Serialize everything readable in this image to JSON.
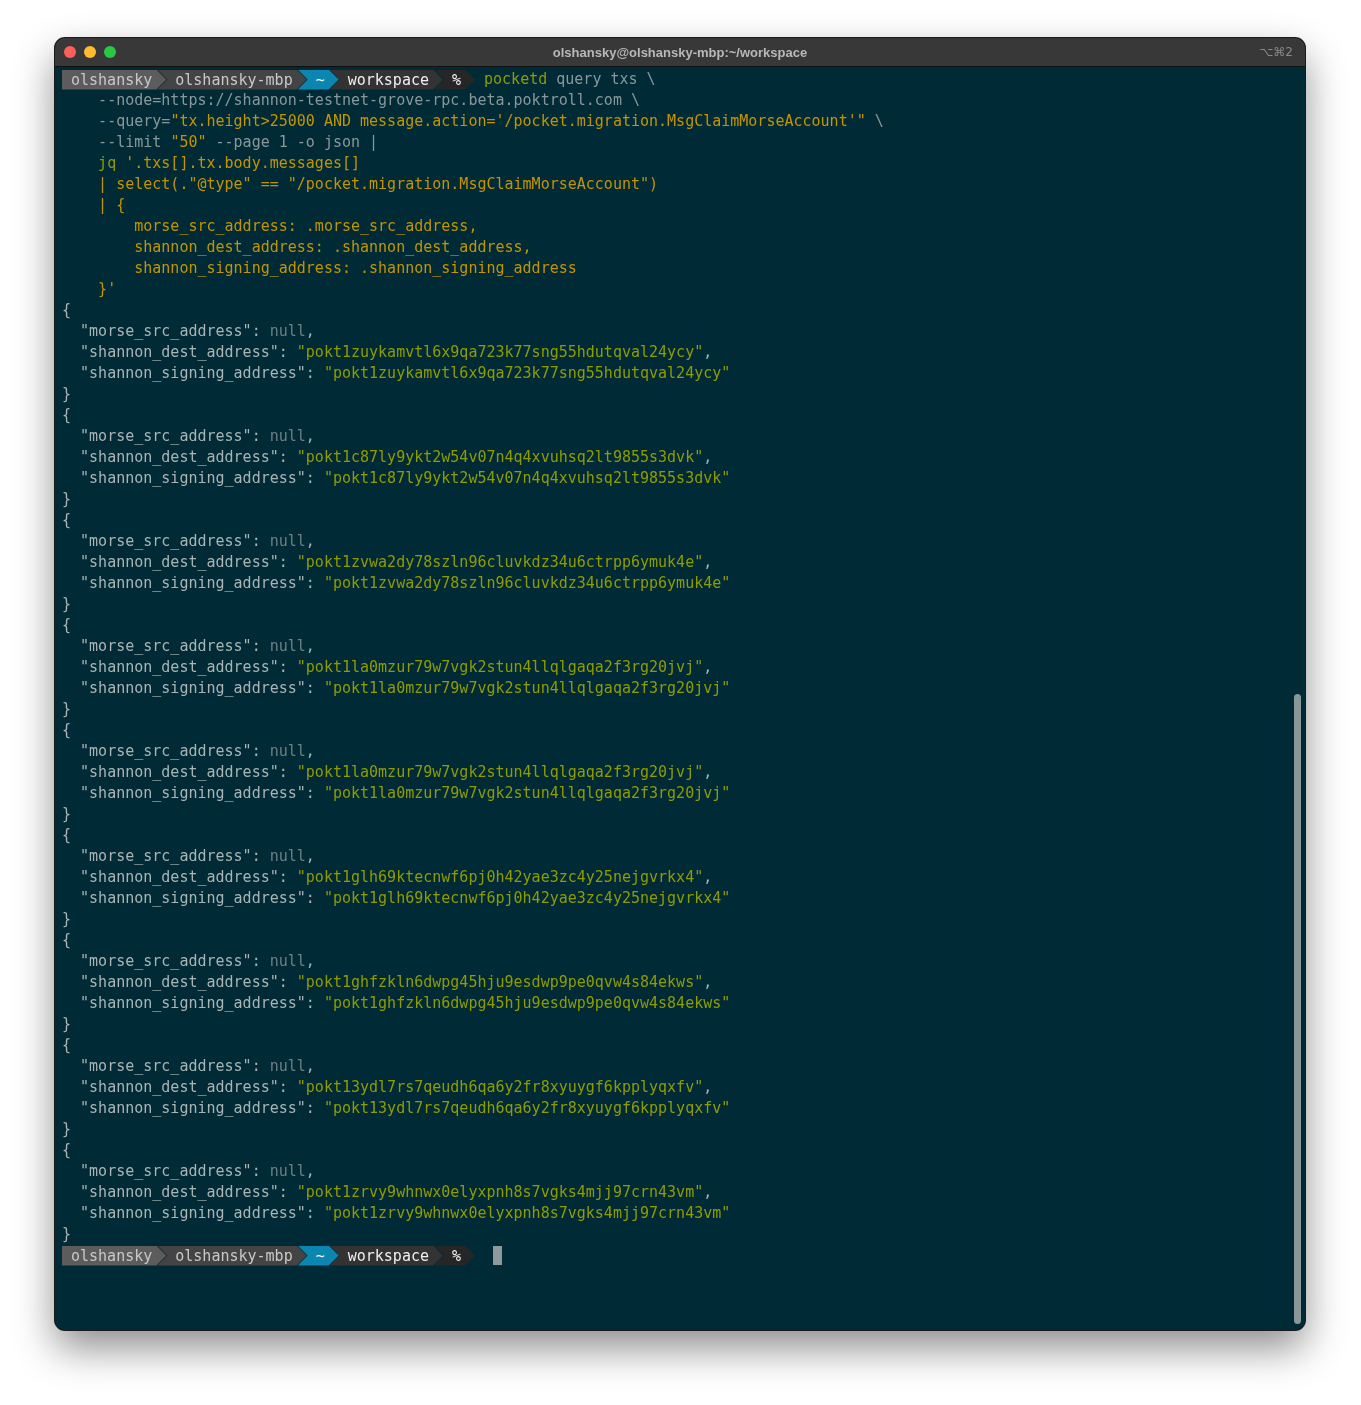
{
  "window": {
    "title": "olshansky@olshansky-mbp:~/workspace",
    "shortcut": "⌥⌘2"
  },
  "terminal": {
    "lines": [
      {
        "kind": "prompt",
        "cursor": false,
        "segments": [
          {
            "text": "olshansky",
            "kind": "user"
          },
          {
            "text": "olshansky-mbp",
            "kind": "host"
          },
          {
            "text": "~",
            "kind": "home"
          },
          {
            "text": "workspace",
            "kind": "dir"
          },
          {
            "text": "%",
            "kind": "symbol"
          }
        ],
        "spans": [
          {
            "text": "pocketd",
            "kind": "command"
          },
          {
            "text": " query txs \\",
            "kind": "plain"
          }
        ]
      },
      {
        "kind": "text",
        "spans": [
          {
            "text": "    --node=https://shannon-testnet-grove-rpc.beta.poktroll.com \\",
            "kind": "plain"
          }
        ]
      },
      {
        "kind": "text",
        "spans": [
          {
            "text": "    --query=",
            "kind": "plain"
          },
          {
            "text": "\"tx.height>25000 AND message.action='/pocket.migration.MsgClaimMorseAccount'\"",
            "kind": "string"
          },
          {
            "text": " \\",
            "kind": "plain"
          }
        ]
      },
      {
        "kind": "text",
        "spans": [
          {
            "text": "    --limit ",
            "kind": "plain"
          },
          {
            "text": "\"50\"",
            "kind": "string"
          },
          {
            "text": " --page 1 -o json |",
            "kind": "plain"
          }
        ]
      },
      {
        "kind": "text",
        "spans": [
          {
            "text": "    jq",
            "kind": "command"
          },
          {
            "text": " '.txs[].tx.body.messages[]",
            "kind": "string"
          }
        ]
      },
      {
        "kind": "text",
        "spans": [
          {
            "text": "    | select(.\"@type\" == \"/pocket.migration.MsgClaimMorseAccount\")",
            "kind": "string"
          }
        ]
      },
      {
        "kind": "text",
        "spans": [
          {
            "text": "    | {",
            "kind": "string"
          }
        ]
      },
      {
        "kind": "text",
        "spans": [
          {
            "text": "        morse_src_address: .morse_src_address,",
            "kind": "string"
          }
        ]
      },
      {
        "kind": "text",
        "spans": [
          {
            "text": "        shannon_dest_address: .shannon_dest_address,",
            "kind": "string"
          }
        ]
      },
      {
        "kind": "text",
        "spans": [
          {
            "text": "        shannon_signing_address: .shannon_signing_address",
            "kind": "string"
          }
        ]
      },
      {
        "kind": "text",
        "spans": [
          {
            "text": "    }'",
            "kind": "string"
          }
        ]
      },
      {
        "kind": "text",
        "spans": [
          {
            "text": "{",
            "kind": "key"
          }
        ]
      },
      {
        "kind": "text",
        "spans": [
          {
            "text": "  \"morse_src_address\": ",
            "kind": "key"
          },
          {
            "text": "null",
            "kind": "null"
          },
          {
            "text": ",",
            "kind": "key"
          }
        ]
      },
      {
        "kind": "text",
        "spans": [
          {
            "text": "  \"shannon_dest_address\": ",
            "kind": "key"
          },
          {
            "text": "\"pokt1zuykamvtl6x9qa723k77sng55hdutqval24ycy\"",
            "kind": "value"
          },
          {
            "text": ",",
            "kind": "key"
          }
        ]
      },
      {
        "kind": "text",
        "spans": [
          {
            "text": "  \"shannon_signing_address\": ",
            "kind": "key"
          },
          {
            "text": "\"pokt1zuykamvtl6x9qa723k77sng55hdutqval24ycy\"",
            "kind": "value"
          }
        ]
      },
      {
        "kind": "text",
        "spans": [
          {
            "text": "}",
            "kind": "key"
          }
        ]
      },
      {
        "kind": "text",
        "spans": [
          {
            "text": "{",
            "kind": "key"
          }
        ]
      },
      {
        "kind": "text",
        "spans": [
          {
            "text": "  \"morse_src_address\": ",
            "kind": "key"
          },
          {
            "text": "null",
            "kind": "null"
          },
          {
            "text": ",",
            "kind": "key"
          }
        ]
      },
      {
        "kind": "text",
        "spans": [
          {
            "text": "  \"shannon_dest_address\": ",
            "kind": "key"
          },
          {
            "text": "\"pokt1c87ly9ykt2w54v07n4q4xvuhsq2lt9855s3dvk\"",
            "kind": "value"
          },
          {
            "text": ",",
            "kind": "key"
          }
        ]
      },
      {
        "kind": "text",
        "spans": [
          {
            "text": "  \"shannon_signing_address\": ",
            "kind": "key"
          },
          {
            "text": "\"pokt1c87ly9ykt2w54v07n4q4xvuhsq2lt9855s3dvk\"",
            "kind": "value"
          }
        ]
      },
      {
        "kind": "text",
        "spans": [
          {
            "text": "}",
            "kind": "key"
          }
        ]
      },
      {
        "kind": "text",
        "spans": [
          {
            "text": "{",
            "kind": "key"
          }
        ]
      },
      {
        "kind": "text",
        "spans": [
          {
            "text": "  \"morse_src_address\": ",
            "kind": "key"
          },
          {
            "text": "null",
            "kind": "null"
          },
          {
            "text": ",",
            "kind": "key"
          }
        ]
      },
      {
        "kind": "text",
        "spans": [
          {
            "text": "  \"shannon_dest_address\": ",
            "kind": "key"
          },
          {
            "text": "\"pokt1zvwa2dy78szln96cluvkdz34u6ctrpp6ymuk4e\"",
            "kind": "value"
          },
          {
            "text": ",",
            "kind": "key"
          }
        ]
      },
      {
        "kind": "text",
        "spans": [
          {
            "text": "  \"shannon_signing_address\": ",
            "kind": "key"
          },
          {
            "text": "\"pokt1zvwa2dy78szln96cluvkdz34u6ctrpp6ymuk4e\"",
            "kind": "value"
          }
        ]
      },
      {
        "kind": "text",
        "spans": [
          {
            "text": "}",
            "kind": "key"
          }
        ]
      },
      {
        "kind": "text",
        "spans": [
          {
            "text": "{",
            "kind": "key"
          }
        ]
      },
      {
        "kind": "text",
        "spans": [
          {
            "text": "  \"morse_src_address\": ",
            "kind": "key"
          },
          {
            "text": "null",
            "kind": "null"
          },
          {
            "text": ",",
            "kind": "key"
          }
        ]
      },
      {
        "kind": "text",
        "spans": [
          {
            "text": "  \"shannon_dest_address\": ",
            "kind": "key"
          },
          {
            "text": "\"pokt1la0mzur79w7vgk2stun4llqlgaqa2f3rg20jvj\"",
            "kind": "value"
          },
          {
            "text": ",",
            "kind": "key"
          }
        ]
      },
      {
        "kind": "text",
        "spans": [
          {
            "text": "  \"shannon_signing_address\": ",
            "kind": "key"
          },
          {
            "text": "\"pokt1la0mzur79w7vgk2stun4llqlgaqa2f3rg20jvj\"",
            "kind": "value"
          }
        ]
      },
      {
        "kind": "text",
        "spans": [
          {
            "text": "}",
            "kind": "key"
          }
        ]
      },
      {
        "kind": "text",
        "spans": [
          {
            "text": "{",
            "kind": "key"
          }
        ]
      },
      {
        "kind": "text",
        "spans": [
          {
            "text": "  \"morse_src_address\": ",
            "kind": "key"
          },
          {
            "text": "null",
            "kind": "null"
          },
          {
            "text": ",",
            "kind": "key"
          }
        ]
      },
      {
        "kind": "text",
        "spans": [
          {
            "text": "  \"shannon_dest_address\": ",
            "kind": "key"
          },
          {
            "text": "\"pokt1la0mzur79w7vgk2stun4llqlgaqa2f3rg20jvj\"",
            "kind": "value"
          },
          {
            "text": ",",
            "kind": "key"
          }
        ]
      },
      {
        "kind": "text",
        "spans": [
          {
            "text": "  \"shannon_signing_address\": ",
            "kind": "key"
          },
          {
            "text": "\"pokt1la0mzur79w7vgk2stun4llqlgaqa2f3rg20jvj\"",
            "kind": "value"
          }
        ]
      },
      {
        "kind": "text",
        "spans": [
          {
            "text": "}",
            "kind": "key"
          }
        ]
      },
      {
        "kind": "text",
        "spans": [
          {
            "text": "{",
            "kind": "key"
          }
        ]
      },
      {
        "kind": "text",
        "spans": [
          {
            "text": "  \"morse_src_address\": ",
            "kind": "key"
          },
          {
            "text": "null",
            "kind": "null"
          },
          {
            "text": ",",
            "kind": "key"
          }
        ]
      },
      {
        "kind": "text",
        "spans": [
          {
            "text": "  \"shannon_dest_address\": ",
            "kind": "key"
          },
          {
            "text": "\"pokt1glh69ktecnwf6pj0h42yae3zc4y25nejgvrkx4\"",
            "kind": "value"
          },
          {
            "text": ",",
            "kind": "key"
          }
        ]
      },
      {
        "kind": "text",
        "spans": [
          {
            "text": "  \"shannon_signing_address\": ",
            "kind": "key"
          },
          {
            "text": "\"pokt1glh69ktecnwf6pj0h42yae3zc4y25nejgvrkx4\"",
            "kind": "value"
          }
        ]
      },
      {
        "kind": "text",
        "spans": [
          {
            "text": "}",
            "kind": "key"
          }
        ]
      },
      {
        "kind": "text",
        "spans": [
          {
            "text": "{",
            "kind": "key"
          }
        ]
      },
      {
        "kind": "text",
        "spans": [
          {
            "text": "  \"morse_src_address\": ",
            "kind": "key"
          },
          {
            "text": "null",
            "kind": "null"
          },
          {
            "text": ",",
            "kind": "key"
          }
        ]
      },
      {
        "kind": "text",
        "spans": [
          {
            "text": "  \"shannon_dest_address\": ",
            "kind": "key"
          },
          {
            "text": "\"pokt1ghfzkln6dwpg45hju9esdwp9pe0qvw4s84ekws\"",
            "kind": "value"
          },
          {
            "text": ",",
            "kind": "key"
          }
        ]
      },
      {
        "kind": "text",
        "spans": [
          {
            "text": "  \"shannon_signing_address\": ",
            "kind": "key"
          },
          {
            "text": "\"pokt1ghfzkln6dwpg45hju9esdwp9pe0qvw4s84ekws\"",
            "kind": "value"
          }
        ]
      },
      {
        "kind": "text",
        "spans": [
          {
            "text": "}",
            "kind": "key"
          }
        ]
      },
      {
        "kind": "text",
        "spans": [
          {
            "text": "{",
            "kind": "key"
          }
        ]
      },
      {
        "kind": "text",
        "spans": [
          {
            "text": "  \"morse_src_address\": ",
            "kind": "key"
          },
          {
            "text": "null",
            "kind": "null"
          },
          {
            "text": ",",
            "kind": "key"
          }
        ]
      },
      {
        "kind": "text",
        "spans": [
          {
            "text": "  \"shannon_dest_address\": ",
            "kind": "key"
          },
          {
            "text": "\"pokt13ydl7rs7qeudh6qa6y2fr8xyuygf6kpplyqxfv\"",
            "kind": "value"
          },
          {
            "text": ",",
            "kind": "key"
          }
        ]
      },
      {
        "kind": "text",
        "spans": [
          {
            "text": "  \"shannon_signing_address\": ",
            "kind": "key"
          },
          {
            "text": "\"pokt13ydl7rs7qeudh6qa6y2fr8xyuygf6kpplyqxfv\"",
            "kind": "value"
          }
        ]
      },
      {
        "kind": "text",
        "spans": [
          {
            "text": "}",
            "kind": "key"
          }
        ]
      },
      {
        "kind": "text",
        "spans": [
          {
            "text": "{",
            "kind": "key"
          }
        ]
      },
      {
        "kind": "text",
        "spans": [
          {
            "text": "  \"morse_src_address\": ",
            "kind": "key"
          },
          {
            "text": "null",
            "kind": "null"
          },
          {
            "text": ",",
            "kind": "key"
          }
        ]
      },
      {
        "kind": "text",
        "spans": [
          {
            "text": "  \"shannon_dest_address\": ",
            "kind": "key"
          },
          {
            "text": "\"pokt1zrvy9whnwx0elyxpnh8s7vgks4mjj97crn43vm\"",
            "kind": "value"
          },
          {
            "text": ",",
            "kind": "key"
          }
        ]
      },
      {
        "kind": "text",
        "spans": [
          {
            "text": "  \"shannon_signing_address\": ",
            "kind": "key"
          },
          {
            "text": "\"pokt1zrvy9whnwx0elyxpnh8s7vgks4mjj97crn43vm\"",
            "kind": "value"
          }
        ]
      },
      {
        "kind": "text",
        "spans": [
          {
            "text": "}",
            "kind": "key"
          }
        ]
      },
      {
        "kind": "prompt",
        "cursor": true,
        "segments": [
          {
            "text": "olshansky",
            "kind": "user"
          },
          {
            "text": "olshansky-mbp",
            "kind": "host"
          },
          {
            "text": "~",
            "kind": "home"
          },
          {
            "text": "workspace",
            "kind": "dir"
          },
          {
            "text": "%",
            "kind": "symbol"
          }
        ]
      }
    ]
  }
}
